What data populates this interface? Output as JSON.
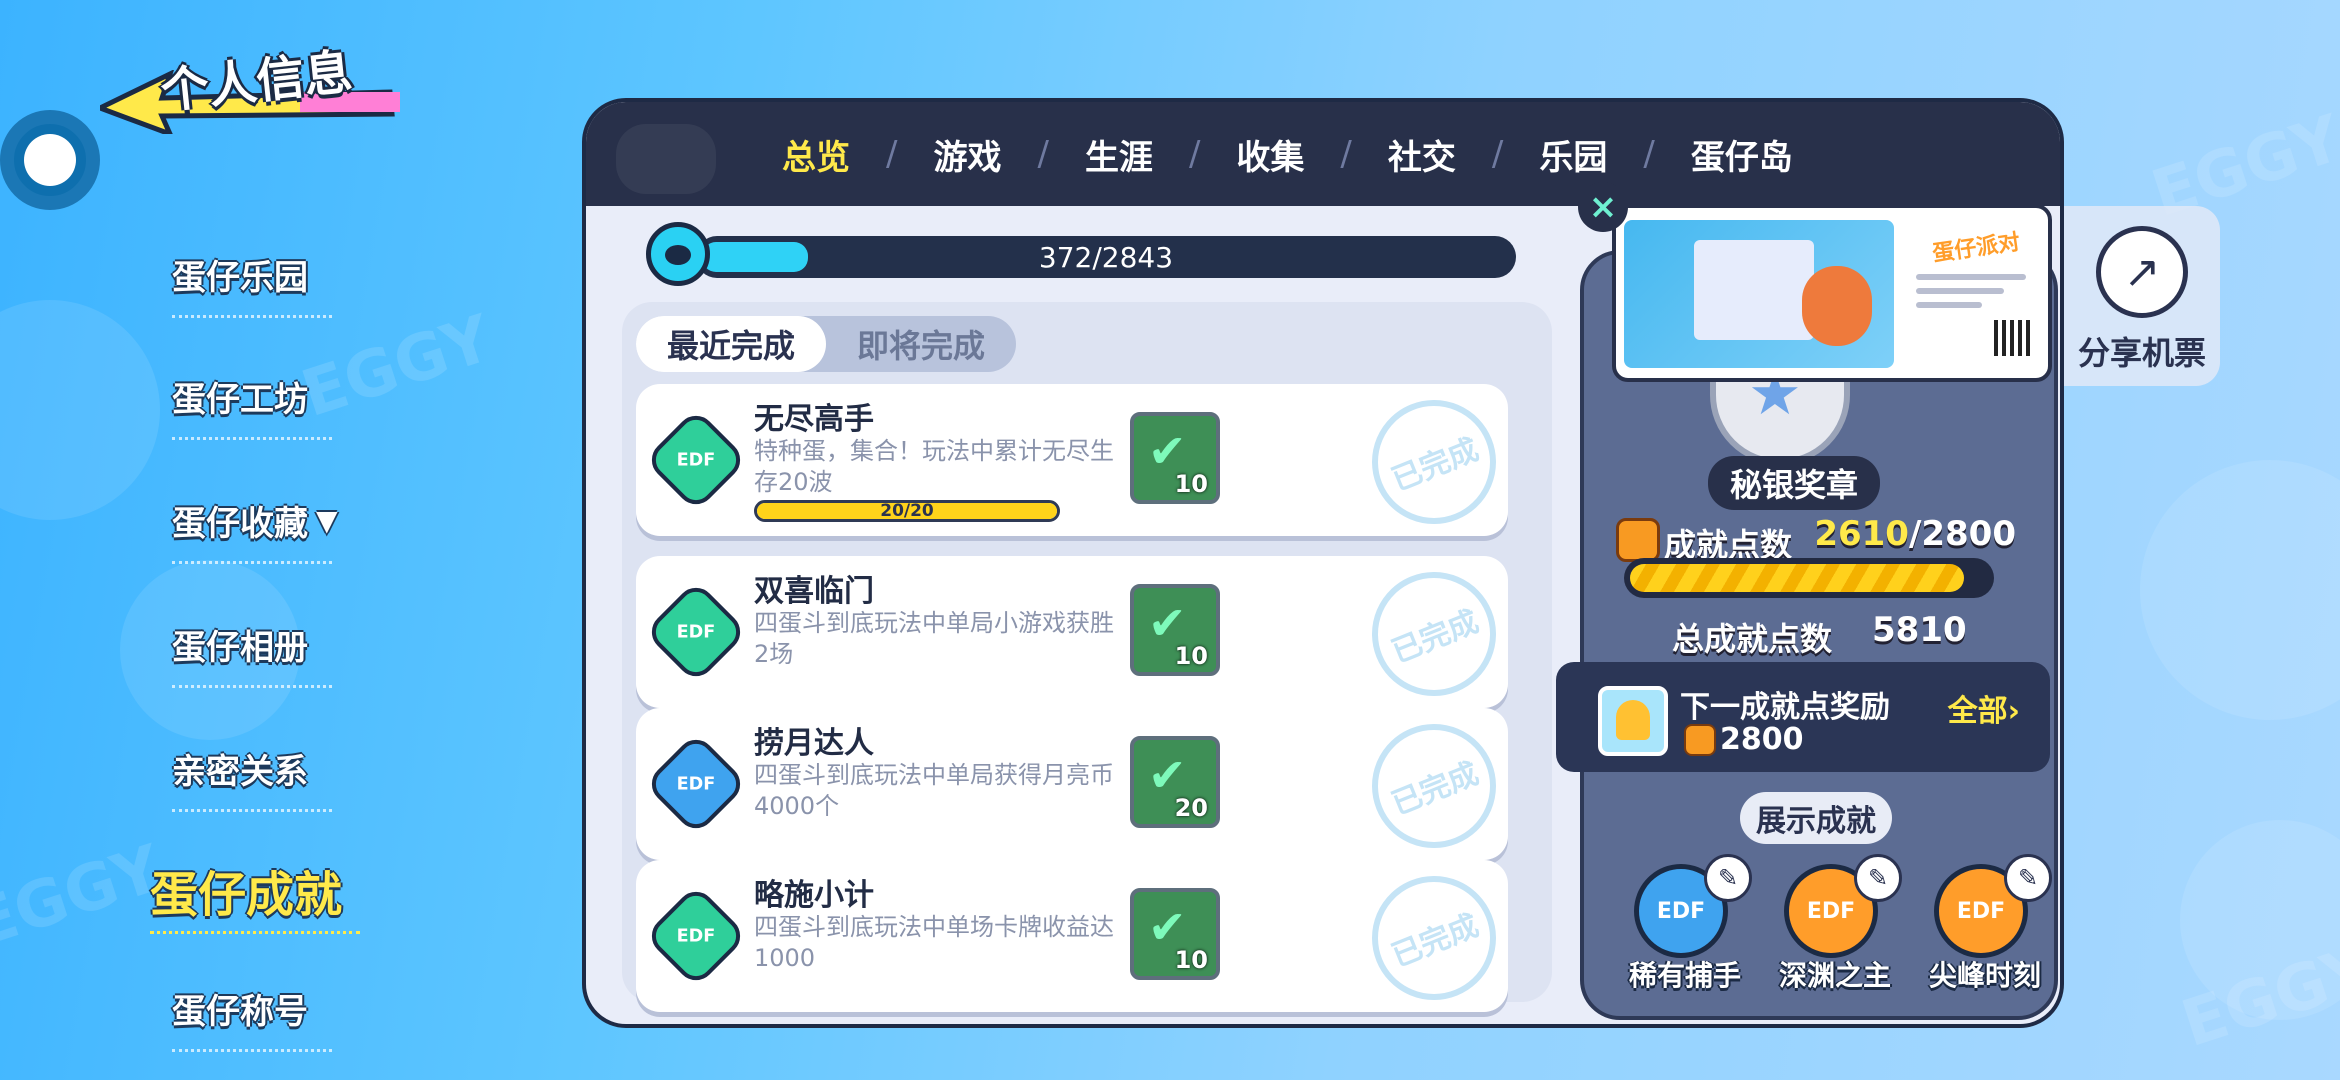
{
  "header": {
    "title": "个人信息"
  },
  "side_menu": {
    "items": [
      {
        "label": "蛋仔乐园"
      },
      {
        "label": "蛋仔工坊"
      },
      {
        "label": "蛋仔收藏",
        "chevron": "▼"
      },
      {
        "label": "蛋仔相册"
      },
      {
        "label": "亲密关系"
      },
      {
        "label": "蛋仔成就",
        "active": true
      },
      {
        "label": "蛋仔称号"
      }
    ]
  },
  "tabs": [
    "总览",
    "游戏",
    "生涯",
    "收集",
    "社交",
    "乐园",
    "蛋仔岛"
  ],
  "tab_separator": "/",
  "progress": {
    "text": "372/2843",
    "current": 372,
    "total": 2843
  },
  "sub_tabs": [
    "最近完成",
    "即将完成"
  ],
  "achievements": [
    {
      "title": "无尽高手",
      "desc": "特种蛋，集合！玩法中累计无尽生存20波",
      "bar_text": "20/20",
      "bar_fraction": 1.0,
      "reward": "10",
      "badge_text": "EDF",
      "badge_color": "green",
      "stamp": "已完成"
    },
    {
      "title": "双喜临门",
      "desc": "四蛋斗到底玩法中单局小游戏获胜2场",
      "reward": "10",
      "badge_text": "EDF",
      "badge_color": "green",
      "stamp": "已完成"
    },
    {
      "title": "捞月达人",
      "desc": "四蛋斗到底玩法中单局获得月亮币4000个",
      "reward": "20",
      "badge_text": "EDF",
      "badge_color": "blue",
      "stamp": "已完成"
    },
    {
      "title": "略施小计",
      "desc": "四蛋斗到底玩法中单场卡牌收益达1000",
      "reward": "10",
      "badge_text": "EDF",
      "badge_color": "green",
      "stamp": "已完成"
    }
  ],
  "medal": {
    "name": "秘银奖章"
  },
  "points": {
    "label": "成就点数",
    "current": "2610",
    "max": "/2800",
    "fraction": 0.932
  },
  "total_points": {
    "label": "总成就点数",
    "value": "5810"
  },
  "next_reward": {
    "label": "下一成就点奖励",
    "value": "2800",
    "all_label": "全部›"
  },
  "display": {
    "title": "展示成就",
    "items": [
      {
        "name": "稀有捕手",
        "badge_text": "EDF",
        "color": "#3fa3ef"
      },
      {
        "name": "深渊之主",
        "badge_text": "EDF",
        "color": "#ff9d2a"
      },
      {
        "name": "尖峰时刻",
        "badge_text": "EDF",
        "color": "#ff9d2a"
      }
    ]
  },
  "share": {
    "label": "分享机票",
    "ticket_brand": "蛋仔派对",
    "close_icon": "×",
    "share_icon": "↗"
  },
  "colors": {
    "accent_yellow": "#ffe94a",
    "panel_dark": "#28304a"
  }
}
